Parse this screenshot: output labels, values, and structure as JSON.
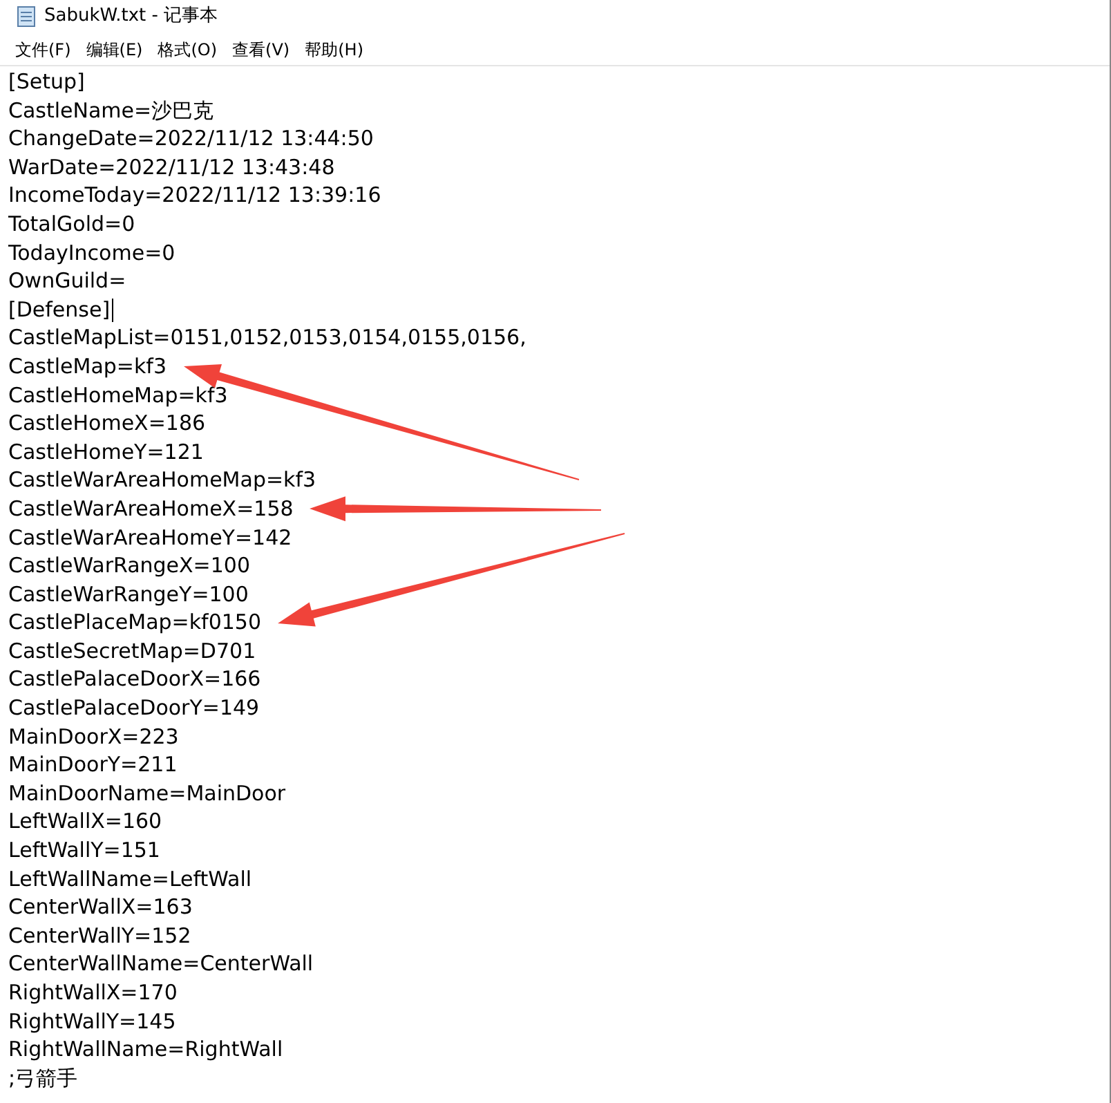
{
  "window": {
    "title": "SabukW.txt - 记事本"
  },
  "menu": [
    "文件(F)",
    "编辑(E)",
    "格式(O)",
    "查看(V)",
    "帮助(H)"
  ],
  "lines": [
    {
      "text": "[Setup]"
    },
    {
      "text": "CastleName=沙巴克"
    },
    {
      "text": "ChangeDate=2022/11/12 13:44:50"
    },
    {
      "text": "WarDate=2022/11/12 13:43:48"
    },
    {
      "text": "IncomeToday=2022/11/12 13:39:16"
    },
    {
      "text": "TotalGold=0"
    },
    {
      "text": "TodayIncome=0"
    },
    {
      "text": "OwnGuild="
    },
    {
      "text": "[Defense]",
      "caret": true
    },
    {
      "text": "CastleMapList=0151,0152,0153,0154,0155,0156,"
    },
    {
      "text": "CastleMap=kf3",
      "marked": true
    },
    {
      "text": "CastleHomeMap=kf3"
    },
    {
      "text": "CastleHomeX=186"
    },
    {
      "text": "CastleHomeY=121"
    },
    {
      "text": "CastleWarAreaHomeMap=kf3"
    },
    {
      "text": "CastleWarAreaHomeX=158",
      "marked": true
    },
    {
      "text": "CastleWarAreaHomeY=142"
    },
    {
      "text": "CastleWarRangeX=100"
    },
    {
      "text": "CastleWarRangeY=100"
    },
    {
      "text": "CastlePlaceMap=kf0150",
      "marked": true
    },
    {
      "text": "CastleSecretMap=D701"
    },
    {
      "text": "CastlePalaceDoorX=166"
    },
    {
      "text": "CastlePalaceDoorY=149"
    },
    {
      "text": "MainDoorX=223"
    },
    {
      "text": "MainDoorY=211"
    },
    {
      "text": "MainDoorName=MainDoor"
    },
    {
      "text": "LeftWallX=160"
    },
    {
      "text": "LeftWallY=151"
    },
    {
      "text": "LeftWallName=LeftWall"
    },
    {
      "text": "CenterWallX=163"
    },
    {
      "text": "CenterWallY=152"
    },
    {
      "text": "CenterWallName=CenterWall"
    },
    {
      "text": "RightWallX=170"
    },
    {
      "text": "RightWallY=145"
    },
    {
      "text": "RightWallName=RightWall"
    },
    {
      "text": ";弓箭手"
    }
  ]
}
